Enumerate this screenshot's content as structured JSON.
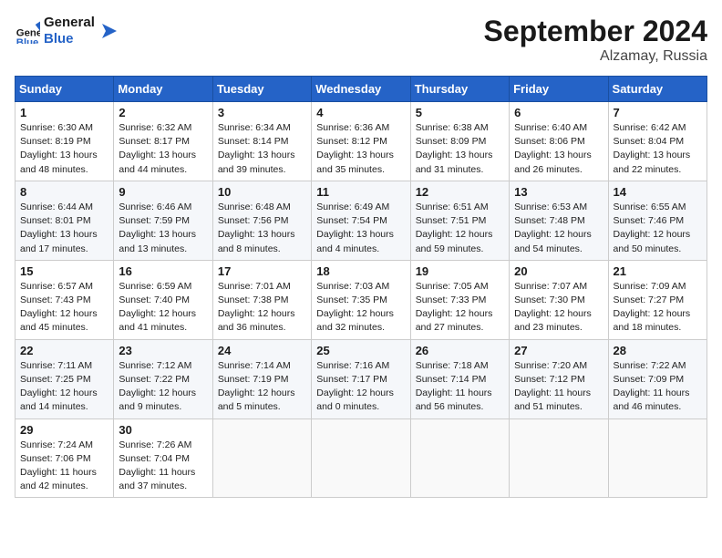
{
  "header": {
    "logo_line1": "General",
    "logo_line2": "Blue",
    "month_title": "September 2024",
    "location": "Alzamay, Russia"
  },
  "weekdays": [
    "Sunday",
    "Monday",
    "Tuesday",
    "Wednesday",
    "Thursday",
    "Friday",
    "Saturday"
  ],
  "weeks": [
    [
      {
        "day": "1",
        "info": "Sunrise: 6:30 AM\nSunset: 8:19 PM\nDaylight: 13 hours\nand 48 minutes."
      },
      {
        "day": "2",
        "info": "Sunrise: 6:32 AM\nSunset: 8:17 PM\nDaylight: 13 hours\nand 44 minutes."
      },
      {
        "day": "3",
        "info": "Sunrise: 6:34 AM\nSunset: 8:14 PM\nDaylight: 13 hours\nand 39 minutes."
      },
      {
        "day": "4",
        "info": "Sunrise: 6:36 AM\nSunset: 8:12 PM\nDaylight: 13 hours\nand 35 minutes."
      },
      {
        "day": "5",
        "info": "Sunrise: 6:38 AM\nSunset: 8:09 PM\nDaylight: 13 hours\nand 31 minutes."
      },
      {
        "day": "6",
        "info": "Sunrise: 6:40 AM\nSunset: 8:06 PM\nDaylight: 13 hours\nand 26 minutes."
      },
      {
        "day": "7",
        "info": "Sunrise: 6:42 AM\nSunset: 8:04 PM\nDaylight: 13 hours\nand 22 minutes."
      }
    ],
    [
      {
        "day": "8",
        "info": "Sunrise: 6:44 AM\nSunset: 8:01 PM\nDaylight: 13 hours\nand 17 minutes."
      },
      {
        "day": "9",
        "info": "Sunrise: 6:46 AM\nSunset: 7:59 PM\nDaylight: 13 hours\nand 13 minutes."
      },
      {
        "day": "10",
        "info": "Sunrise: 6:48 AM\nSunset: 7:56 PM\nDaylight: 13 hours\nand 8 minutes."
      },
      {
        "day": "11",
        "info": "Sunrise: 6:49 AM\nSunset: 7:54 PM\nDaylight: 13 hours\nand 4 minutes."
      },
      {
        "day": "12",
        "info": "Sunrise: 6:51 AM\nSunset: 7:51 PM\nDaylight: 12 hours\nand 59 minutes."
      },
      {
        "day": "13",
        "info": "Sunrise: 6:53 AM\nSunset: 7:48 PM\nDaylight: 12 hours\nand 54 minutes."
      },
      {
        "day": "14",
        "info": "Sunrise: 6:55 AM\nSunset: 7:46 PM\nDaylight: 12 hours\nand 50 minutes."
      }
    ],
    [
      {
        "day": "15",
        "info": "Sunrise: 6:57 AM\nSunset: 7:43 PM\nDaylight: 12 hours\nand 45 minutes."
      },
      {
        "day": "16",
        "info": "Sunrise: 6:59 AM\nSunset: 7:40 PM\nDaylight: 12 hours\nand 41 minutes."
      },
      {
        "day": "17",
        "info": "Sunrise: 7:01 AM\nSunset: 7:38 PM\nDaylight: 12 hours\nand 36 minutes."
      },
      {
        "day": "18",
        "info": "Sunrise: 7:03 AM\nSunset: 7:35 PM\nDaylight: 12 hours\nand 32 minutes."
      },
      {
        "day": "19",
        "info": "Sunrise: 7:05 AM\nSunset: 7:33 PM\nDaylight: 12 hours\nand 27 minutes."
      },
      {
        "day": "20",
        "info": "Sunrise: 7:07 AM\nSunset: 7:30 PM\nDaylight: 12 hours\nand 23 minutes."
      },
      {
        "day": "21",
        "info": "Sunrise: 7:09 AM\nSunset: 7:27 PM\nDaylight: 12 hours\nand 18 minutes."
      }
    ],
    [
      {
        "day": "22",
        "info": "Sunrise: 7:11 AM\nSunset: 7:25 PM\nDaylight: 12 hours\nand 14 minutes."
      },
      {
        "day": "23",
        "info": "Sunrise: 7:12 AM\nSunset: 7:22 PM\nDaylight: 12 hours\nand 9 minutes."
      },
      {
        "day": "24",
        "info": "Sunrise: 7:14 AM\nSunset: 7:19 PM\nDaylight: 12 hours\nand 5 minutes."
      },
      {
        "day": "25",
        "info": "Sunrise: 7:16 AM\nSunset: 7:17 PM\nDaylight: 12 hours\nand 0 minutes."
      },
      {
        "day": "26",
        "info": "Sunrise: 7:18 AM\nSunset: 7:14 PM\nDaylight: 11 hours\nand 56 minutes."
      },
      {
        "day": "27",
        "info": "Sunrise: 7:20 AM\nSunset: 7:12 PM\nDaylight: 11 hours\nand 51 minutes."
      },
      {
        "day": "28",
        "info": "Sunrise: 7:22 AM\nSunset: 7:09 PM\nDaylight: 11 hours\nand 46 minutes."
      }
    ],
    [
      {
        "day": "29",
        "info": "Sunrise: 7:24 AM\nSunset: 7:06 PM\nDaylight: 11 hours\nand 42 minutes."
      },
      {
        "day": "30",
        "info": "Sunrise: 7:26 AM\nSunset: 7:04 PM\nDaylight: 11 hours\nand 37 minutes."
      },
      {
        "day": "",
        "info": ""
      },
      {
        "day": "",
        "info": ""
      },
      {
        "day": "",
        "info": ""
      },
      {
        "day": "",
        "info": ""
      },
      {
        "day": "",
        "info": ""
      }
    ]
  ]
}
